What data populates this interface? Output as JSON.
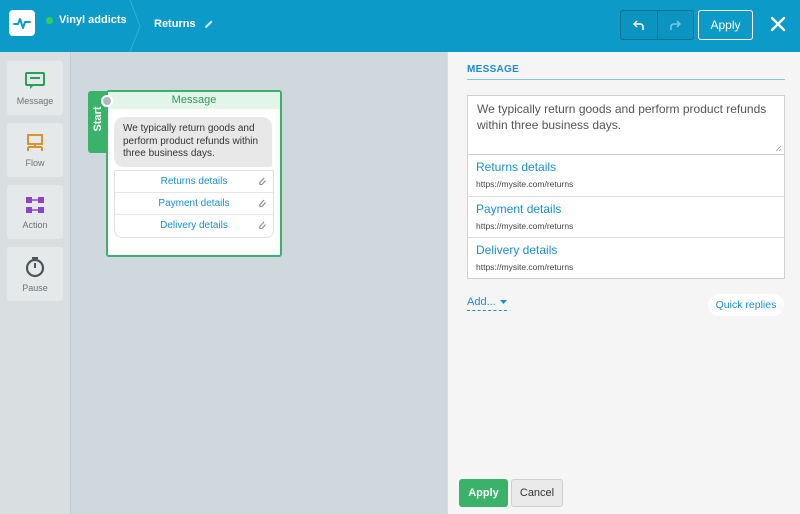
{
  "header": {
    "bot_name": "Vinyl addicts",
    "story_name": "Returns",
    "apply_label": "Apply"
  },
  "toolbar": {
    "items": [
      {
        "label": "Message",
        "icon": "message-icon"
      },
      {
        "label": "Flow",
        "icon": "flow-icon"
      },
      {
        "label": "Action",
        "icon": "action-icon"
      },
      {
        "label": "Pause",
        "icon": "pause-timer-icon"
      }
    ]
  },
  "canvas": {
    "start_label": "Start",
    "node": {
      "title": "Message",
      "text": "We typically return goods and perform product refunds within three business days.",
      "buttons": [
        "Returns details",
        "Payment details",
        "Delivery details"
      ]
    }
  },
  "panel": {
    "section_title": "MESSAGE",
    "message_text": "We typically return goods and perform product refunds within three business days.",
    "buttons": [
      {
        "title": "Returns details",
        "url": "https://mysite.com/returns"
      },
      {
        "title": "Payment details",
        "url": "https://mysite.com/returns"
      },
      {
        "title": "Delivery details",
        "url": "https://mysite.com/returns"
      }
    ],
    "add_label": "Add...",
    "quick_replies_label": "Quick replies",
    "apply_label": "Apply",
    "cancel_label": "Cancel"
  },
  "colors": {
    "header": "#0c9bc9",
    "accent_green": "#3ab26a",
    "link_blue": "#1a8fd1"
  }
}
